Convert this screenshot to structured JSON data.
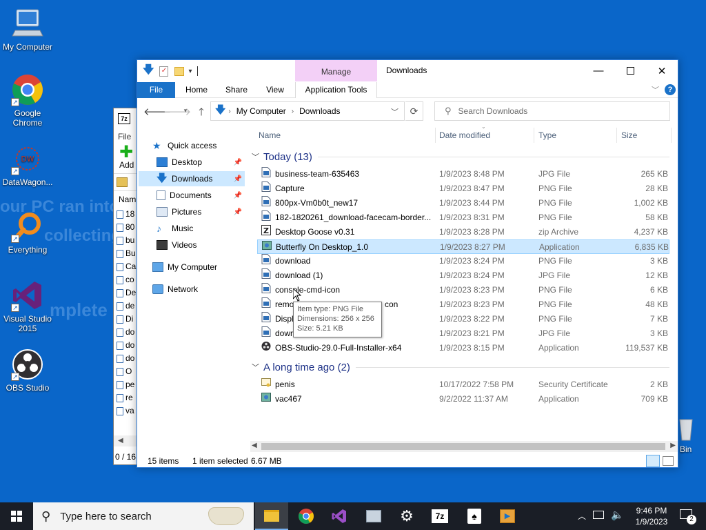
{
  "desktop": {
    "wallpaper_lines": [
      "our PC ran into",
      "collecting s",
      "mplete"
    ],
    "icons": [
      {
        "label": "My Computer"
      },
      {
        "label": "Google Chrome"
      },
      {
        "label": "DataWagon..."
      },
      {
        "label": "Everything"
      },
      {
        "label": "Visual Studio 2015"
      },
      {
        "label": "OBS Studio"
      },
      {
        "label": "Bin"
      }
    ]
  },
  "bg_window": {
    "title_icon": "7z",
    "menu": "File",
    "add_label": "Add",
    "col_header": "Nam",
    "rows": [
      "18",
      "80",
      "bu",
      "Bu",
      "Ca",
      "co",
      "De",
      "de",
      "Di",
      "do",
      "do",
      "do",
      "O",
      "pe",
      "re",
      "va"
    ],
    "status": "0 / 16"
  },
  "explorer": {
    "title": "Downloads",
    "manage_tab": "Manage",
    "ribbon_tabs": [
      "File",
      "Home",
      "Share",
      "View",
      "Application Tools"
    ],
    "address": {
      "segments": [
        "My Computer",
        "Downloads"
      ]
    },
    "search_placeholder": "Search Downloads",
    "nav": [
      {
        "label": "Quick access"
      },
      {
        "label": "Desktop"
      },
      {
        "label": "Downloads"
      },
      {
        "label": "Documents"
      },
      {
        "label": "Pictures"
      },
      {
        "label": "Music"
      },
      {
        "label": "Videos"
      },
      {
        "label": "My Computer"
      },
      {
        "label": "Network"
      }
    ],
    "columns": {
      "name": "Name",
      "date": "Date modified",
      "type": "Type",
      "size": "Size"
    },
    "groups": [
      {
        "label": "Today (13)",
        "files": [
          {
            "name": "business-team-635463",
            "date": "1/9/2023 8:48 PM",
            "type": "JPG File",
            "size": "265 KB",
            "icon": "image-file-icon"
          },
          {
            "name": "Capture",
            "date": "1/9/2023 8:47 PM",
            "type": "PNG File",
            "size": "28 KB",
            "icon": "image-file-icon"
          },
          {
            "name": "800px-Vm0b0t_new17",
            "date": "1/9/2023 8:44 PM",
            "type": "PNG File",
            "size": "1,002 KB",
            "icon": "image-file-icon"
          },
          {
            "name": "182-1820261_download-facecam-border...",
            "date": "1/9/2023 8:31 PM",
            "type": "PNG File",
            "size": "58 KB",
            "icon": "image-file-icon"
          },
          {
            "name": "Desktop Goose v0.31",
            "date": "1/9/2023 8:28 PM",
            "type": "zip Archive",
            "size": "4,237 KB",
            "icon": "zip-file-icon"
          },
          {
            "name": "Butterfly On Desktop_1.0",
            "date": "1/9/2023 8:27 PM",
            "type": "Application",
            "size": "6,835 KB",
            "icon": "application-icon"
          },
          {
            "name": "download",
            "date": "1/9/2023 8:24 PM",
            "type": "PNG File",
            "size": "3 KB",
            "icon": "image-file-icon"
          },
          {
            "name": "download (1)",
            "date": "1/9/2023 8:24 PM",
            "type": "JPG File",
            "size": "12 KB",
            "icon": "image-file-icon"
          },
          {
            "name": "console-cmd-icon",
            "date": "1/9/2023 8:23 PM",
            "type": "PNG File",
            "size": "6 KB",
            "icon": "image-file-icon"
          },
          {
            "name": "remo",
            "name_tail": "con",
            "date": "1/9/2023 8:23 PM",
            "type": "PNG File",
            "size": "48 KB",
            "icon": "image-file-icon"
          },
          {
            "name": "Displ",
            "date": "1/9/2023 8:22 PM",
            "type": "PNG File",
            "size": "7 KB",
            "icon": "image-file-icon"
          },
          {
            "name": "down",
            "date": "1/9/2023 8:21 PM",
            "type": "JPG File",
            "size": "3 KB",
            "icon": "image-file-icon"
          },
          {
            "name": "OBS-Studio-29.0-Full-Installer-x64",
            "date": "1/9/2023 8:15 PM",
            "type": "Application",
            "size": "119,537 KB",
            "icon": "obs-installer-icon"
          }
        ]
      },
      {
        "label": "A long time ago (2)",
        "files": [
          {
            "name": "penis",
            "date": "10/17/2022 7:58 PM",
            "type": "Security Certificate",
            "size": "2 KB",
            "icon": "certificate-icon"
          },
          {
            "name": "vac467",
            "date": "9/2/2022 11:37 AM",
            "type": "Application",
            "size": "709 KB",
            "icon": "application-icon"
          }
        ]
      }
    ],
    "tooltip": {
      "line1": "Item type: PNG File",
      "line2": "Dimensions: 256 x 256",
      "line3": "Size: 5.21 KB"
    },
    "status": {
      "items": "15 items",
      "selected": "1 item selected",
      "size": "6.67 MB"
    }
  },
  "taskbar": {
    "search_placeholder": "Type here to search",
    "time": "9:46 PM",
    "date": "1/9/2023",
    "notification_count": "2",
    "app_7z_label": "7z"
  }
}
